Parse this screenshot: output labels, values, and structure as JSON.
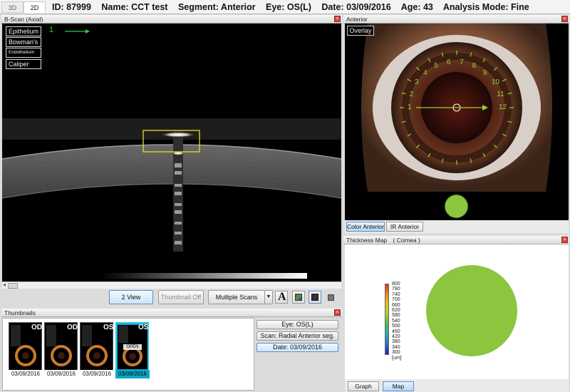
{
  "header": {
    "view_tabs": [
      "3D",
      "2D"
    ],
    "id_text": "ID: 87999",
    "name_text": "Name: CCT test",
    "segment_text": "Segment: Anterior",
    "eye_text": "Eye: OS(L)",
    "date_text": "Date: 03/09/2016",
    "age_text": "Age: 43",
    "mode_text": "Analysis Mode: Fine"
  },
  "bscan": {
    "title": "B-Scan (Axial)",
    "layers": [
      "Epithelium",
      "Bowman's",
      "Endothelium",
      "Caliper"
    ],
    "marker": "1",
    "toolbar": {
      "two_view": "2 View",
      "thumbnail_off": "Thumbnail Off",
      "multiple_scans": "Multiple Scans",
      "font_icon_letter": "A"
    }
  },
  "thumbnails": {
    "title": "Thumbnails",
    "items": [
      {
        "eye": "OD",
        "date": "03/09/2016",
        "selected": false,
        "badge": ""
      },
      {
        "eye": "OD",
        "date": "03/09/2016",
        "selected": false,
        "badge": ""
      },
      {
        "eye": "OS",
        "date": "03/09/2016",
        "selected": false,
        "badge": ""
      },
      {
        "eye": "OS",
        "date": "03/09/2016",
        "selected": true,
        "badge": "OPEN"
      }
    ],
    "filters": {
      "eye": "Eye: OS(L)",
      "scan": "Scan: Radial Anterior seg.",
      "date": "Date: 03/09/2016"
    }
  },
  "anterior": {
    "title": "Anterior",
    "overlay": "Overlay",
    "clock": [
      "1",
      "2",
      "3",
      "4",
      "5",
      "6",
      "7",
      "8",
      "9",
      "10",
      "11",
      "12"
    ],
    "tabs": [
      "Color Anterior",
      "IR Anterior"
    ],
    "selected_tab": "Color Anterior"
  },
  "thickness": {
    "title": "Thickness Map",
    "subtitle": "( Cornea )",
    "scale": [
      "800",
      "780",
      "740",
      "700",
      "660",
      "620",
      "580",
      "540",
      "500",
      "460",
      "420",
      "380",
      "340",
      "300"
    ],
    "unit": "[um]",
    "tabs": [
      "Graph",
      "Map"
    ],
    "selected_tab": "Map",
    "map_color": "#8cc63f"
  }
}
